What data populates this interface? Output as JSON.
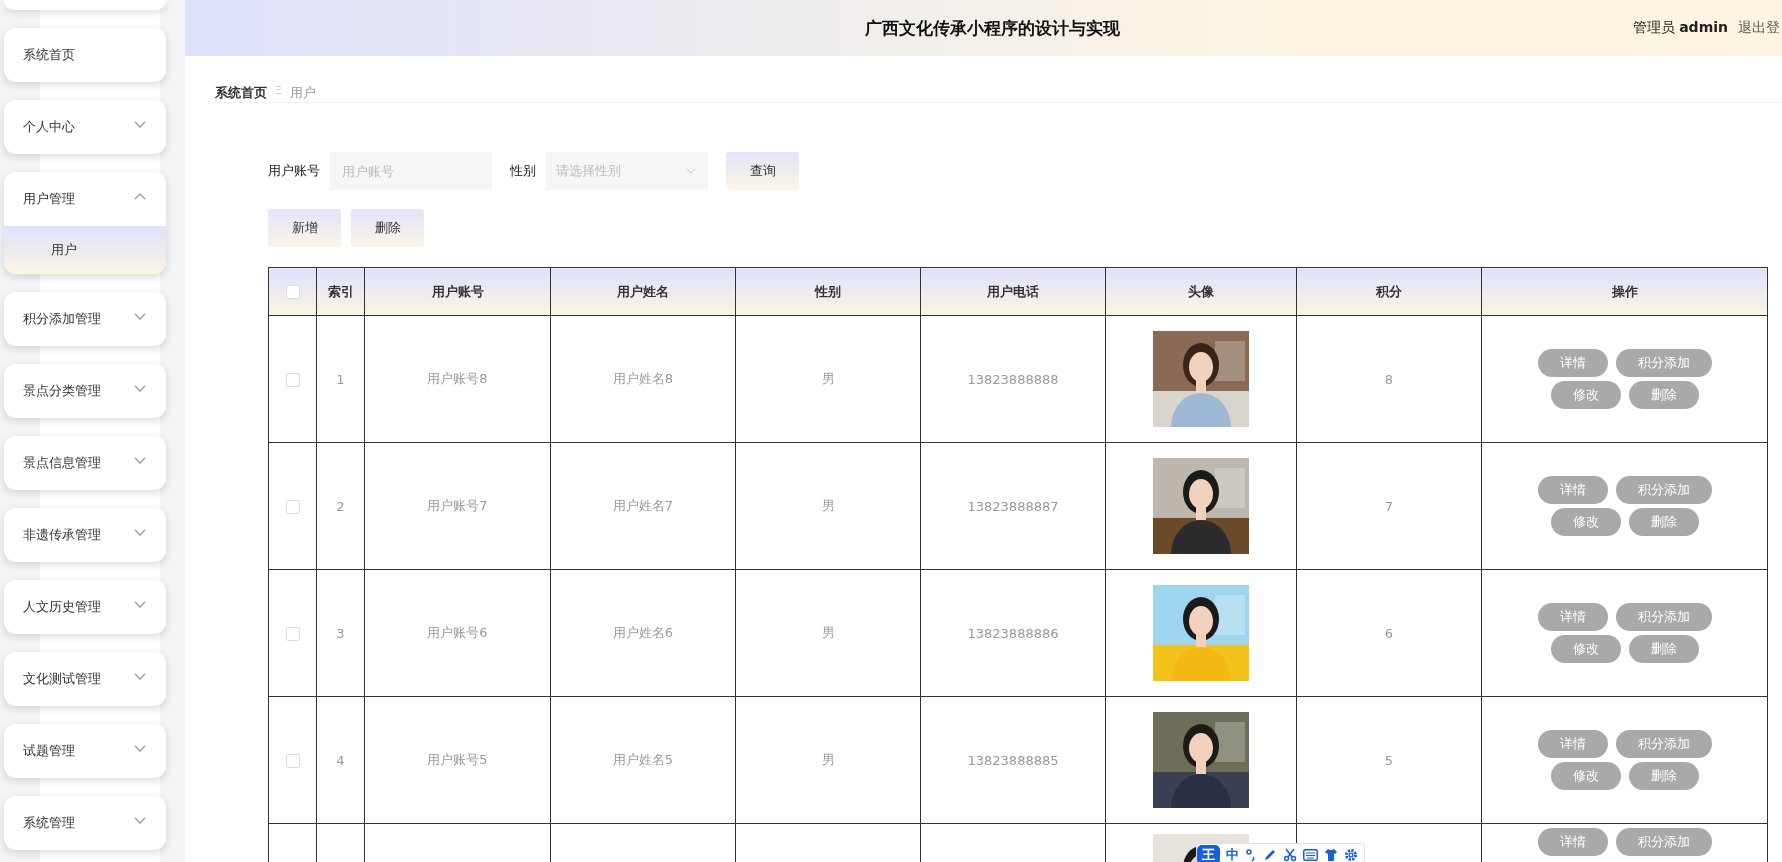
{
  "header": {
    "title": "广西文化传承小程序的设计与实现",
    "user_role": "管理员",
    "user_name": "admin",
    "logout": "退出登"
  },
  "sidebar": {
    "items": [
      {
        "label": "系统首页",
        "kind": "link"
      },
      {
        "label": "个人中心",
        "kind": "submenu",
        "expanded": false
      },
      {
        "label": "用户管理",
        "kind": "submenu",
        "expanded": true,
        "children": [
          {
            "label": "用户",
            "selected": true
          }
        ]
      },
      {
        "label": "积分添加管理",
        "kind": "submenu",
        "expanded": false
      },
      {
        "label": "景点分类管理",
        "kind": "submenu",
        "expanded": false
      },
      {
        "label": "景点信息管理",
        "kind": "submenu",
        "expanded": false
      },
      {
        "label": "非遗传承管理",
        "kind": "submenu",
        "expanded": false
      },
      {
        "label": "人文历史管理",
        "kind": "submenu",
        "expanded": false
      },
      {
        "label": "文化测试管理",
        "kind": "submenu",
        "expanded": false
      },
      {
        "label": "试题管理",
        "kind": "submenu",
        "expanded": false
      },
      {
        "label": "系统管理",
        "kind": "submenu",
        "expanded": false
      }
    ]
  },
  "breadcrumb": [
    {
      "label": "系统首页",
      "current": false
    },
    {
      "label": "用户",
      "current": true
    }
  ],
  "breadcrumb_separator": "Ξ",
  "search": {
    "account_label": "用户账号",
    "account_placeholder": "用户账号",
    "gender_label": "性别",
    "gender_placeholder": "请选择性别",
    "query_button": "查询"
  },
  "actions": [
    "新增",
    "删除"
  ],
  "table": {
    "select_all": {
      "checked": false
    },
    "columns": [
      "索引",
      "用户账号",
      "用户姓名",
      "性别",
      "用户电话",
      "头像",
      "积分",
      "操作"
    ],
    "rows": [
      {
        "checked": false,
        "index": "1",
        "account": "用户账号8",
        "name": "用户姓名8",
        "gender": "男",
        "phone": "13823888888",
        "avatar": {
          "kind": "picture"
        },
        "points": "8",
        "buttons": [
          "详情",
          "积分添加",
          "修改",
          "删除"
        ]
      },
      {
        "checked": false,
        "index": "2",
        "account": "用户账号7",
        "name": "用户姓名7",
        "gender": "男",
        "phone": "13823888887",
        "avatar": {
          "kind": "picture"
        },
        "points": "7",
        "buttons": [
          "详情",
          "积分添加",
          "修改",
          "删除"
        ]
      },
      {
        "checked": false,
        "index": "3",
        "account": "用户账号6",
        "name": "用户姓名6",
        "gender": "男",
        "phone": "13823888886",
        "avatar": {
          "kind": "picture"
        },
        "points": "6",
        "buttons": [
          "详情",
          "积分添加",
          "修改",
          "删除"
        ]
      },
      {
        "checked": false,
        "index": "4",
        "account": "用户账号5",
        "name": "用户姓名5",
        "gender": "男",
        "phone": "13823888885",
        "avatar": {
          "kind": "picture"
        },
        "points": "5",
        "buttons": [
          "详情",
          "积分添加",
          "修改",
          "删除"
        ]
      },
      {
        "avatar": {
          "kind": "picture"
        },
        "buttons": [
          "详情",
          "积分添加"
        ]
      }
    ]
  },
  "ime_toolbar": {
    "logo": "王",
    "mode": "中"
  }
}
